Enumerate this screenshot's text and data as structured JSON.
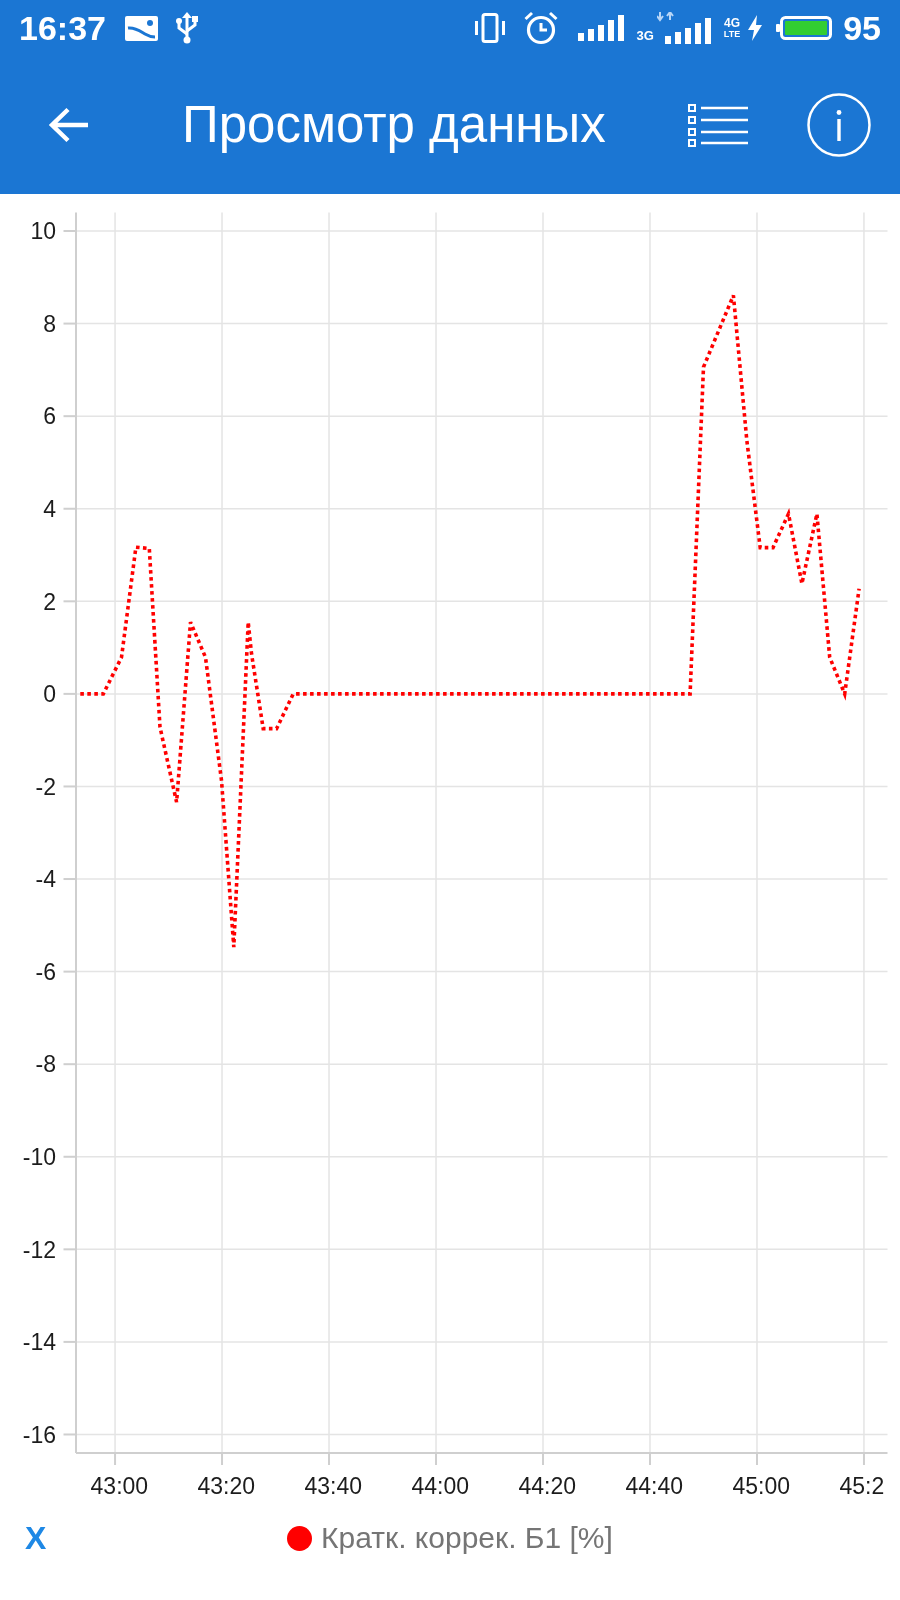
{
  "status_bar": {
    "time": "16:37",
    "network_labels": [
      "3G",
      "4G",
      "LTE"
    ],
    "battery_percent": "95"
  },
  "toolbar": {
    "title": "Просмотр данных"
  },
  "chart": {
    "chart_data": {
      "type": "line",
      "grid": true,
      "x": [
        2573.5,
        2577.8,
        2581.2,
        2583.9,
        2586.4,
        2588.4,
        2591.5,
        2594.1,
        2596.9,
        2599.9,
        2602.2,
        2604.9,
        2605.5,
        2607.7,
        2610.2,
        2613.3,
        2687.5,
        2690,
        2695.6,
        2698.1,
        2700.6,
        2703,
        2705.9,
        2708.4,
        2711.2,
        2713.6,
        2716.4,
        2719.1
      ],
      "series": [
        {
          "name": "Кратк. коррек. Б1 [%]",
          "color": "#ff0000",
          "line_style": "dotted",
          "values": [
            0,
            0,
            0.79,
            3.17,
            3.14,
            -0.72,
            -2.34,
            1.55,
            0.79,
            -1.87,
            -5.47,
            1.55,
            0.87,
            -0.75,
            -0.75,
            0,
            0,
            7.06,
            8.61,
            5.48,
            3.16,
            3.16,
            3.89,
            2.38,
            3.89,
            0.79,
            0,
            2.27
          ]
        }
      ],
      "xlim": [
        2572.7,
        2724.4
      ],
      "ylim": [
        -16.4,
        10.4
      ],
      "xticks": [
        {
          "value": 2580,
          "label": "43:00"
        },
        {
          "value": 2600,
          "label": "43:20"
        },
        {
          "value": 2620,
          "label": "43:40"
        },
        {
          "value": 2640,
          "label": "44:00"
        },
        {
          "value": 2660,
          "label": "44:20"
        },
        {
          "value": 2680,
          "label": "44:40"
        },
        {
          "value": 2700,
          "label": "45:00"
        },
        {
          "value": 2720,
          "label": "45:2"
        }
      ],
      "yticks": [
        10,
        8,
        6,
        4,
        2,
        0,
        -2,
        -4,
        -6,
        -8,
        -10,
        -12,
        -14,
        -16
      ]
    }
  },
  "x_button": "X"
}
